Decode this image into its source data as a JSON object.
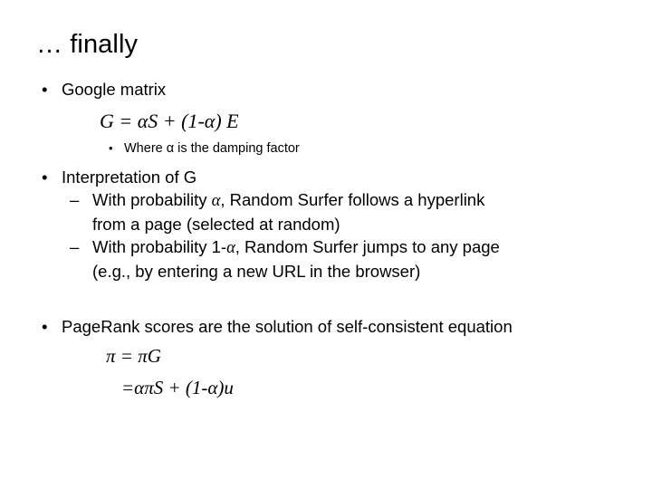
{
  "slide": {
    "title": "… finally",
    "background_color": "#ffffff",
    "text_color": "#000000"
  },
  "content": {
    "bullet1": {
      "label": "Google matrix",
      "equation": {
        "lhs": "G",
        "eq": " = ",
        "rhs_a": "αS",
        "plus": " + ",
        "rhs_b": "(1-α) E",
        "full": "G = αS + (1-α) E"
      },
      "subbullet": {
        "prefix": "Where ",
        "symbol": "α",
        "suffix": " is the damping factor",
        "full": "Where α is the damping factor"
      }
    },
    "bullet2": {
      "label_prefix": "Interpretation of ",
      "label_symbol": "G",
      "label_full": "Interpretation of G",
      "dashes": [
        {
          "line1_prefix": "With probability ",
          "line1_symbol": "α",
          "line1_suffix": ", Random Surfer follows a hyperlink",
          "line2": "from a page (selected at random)",
          "full": "With probability α, Random Surfer follows a hyperlink from a page (selected at random)"
        },
        {
          "line1_prefix": "With probability 1-",
          "line1_symbol": "α",
          "line1_suffix": ", Random Surfer jumps to any page",
          "line2": "(e.g., by entering a new URL in the browser)",
          "full": "With probability 1-α, Random Surfer jumps to any page (e.g., by entering a new URL in the browser)"
        }
      ]
    },
    "bullet3": {
      "label": "PageRank scores are the solution of self-consistent equation",
      "equations": [
        {
          "full": "π = πG"
        },
        {
          "full": "=απS + (1-α)u"
        }
      ]
    }
  },
  "markers": {
    "bullet_dot": "•",
    "dash": "–"
  }
}
